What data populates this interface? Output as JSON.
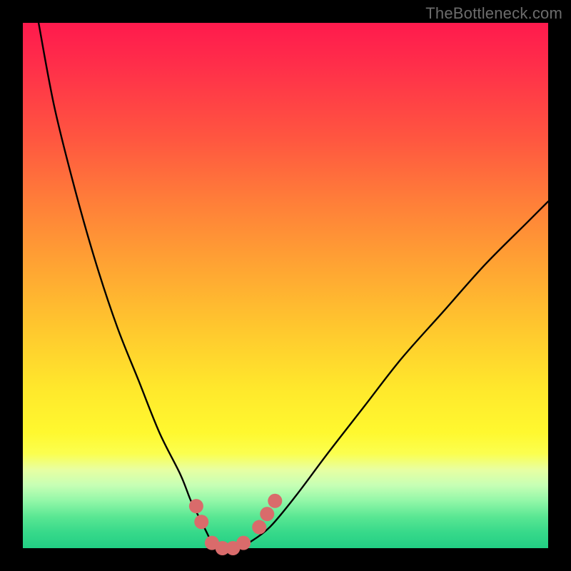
{
  "watermark": "TheBottleneck.com",
  "chart_data": {
    "type": "line",
    "title": "",
    "xlabel": "",
    "ylabel": "",
    "xlim": [
      0,
      100
    ],
    "ylim": [
      0,
      100
    ],
    "series": [
      {
        "name": "curve",
        "x": [
          3,
          6,
          10,
          14,
          18,
          22,
          26,
          30,
          32,
          34,
          35,
          36,
          37,
          39,
          41,
          43,
          47,
          52,
          58,
          65,
          72,
          80,
          88,
          96,
          100
        ],
        "y": [
          100,
          84,
          68,
          54,
          42,
          32,
          22,
          14,
          9,
          5,
          3,
          1,
          0,
          0,
          0,
          1,
          4,
          10,
          18,
          27,
          36,
          45,
          54,
          62,
          66
        ]
      }
    ],
    "markers": [
      {
        "name": "dot-left-upper",
        "x": 33.0,
        "y": 8.0
      },
      {
        "name": "dot-left-lower",
        "x": 34.0,
        "y": 5.0
      },
      {
        "name": "dot-valley-1",
        "x": 36.0,
        "y": 1.0
      },
      {
        "name": "dot-valley-2",
        "x": 38.0,
        "y": 0.0
      },
      {
        "name": "dot-valley-3",
        "x": 40.0,
        "y": 0.0
      },
      {
        "name": "dot-valley-4",
        "x": 42.0,
        "y": 1.0
      },
      {
        "name": "dot-right-lower",
        "x": 45.0,
        "y": 4.0
      },
      {
        "name": "dot-right-mid",
        "x": 46.5,
        "y": 6.5
      },
      {
        "name": "dot-right-upper",
        "x": 48.0,
        "y": 9.0
      }
    ],
    "colors": {
      "curve": "#000000",
      "marker": "#d96b6b"
    },
    "background_gradient": [
      {
        "stop": 0.0,
        "color": "#ff1a4d"
      },
      {
        "stop": 0.5,
        "color": "#ffb831"
      },
      {
        "stop": 0.8,
        "color": "#fff82f"
      },
      {
        "stop": 1.0,
        "color": "#22cf84"
      }
    ]
  }
}
